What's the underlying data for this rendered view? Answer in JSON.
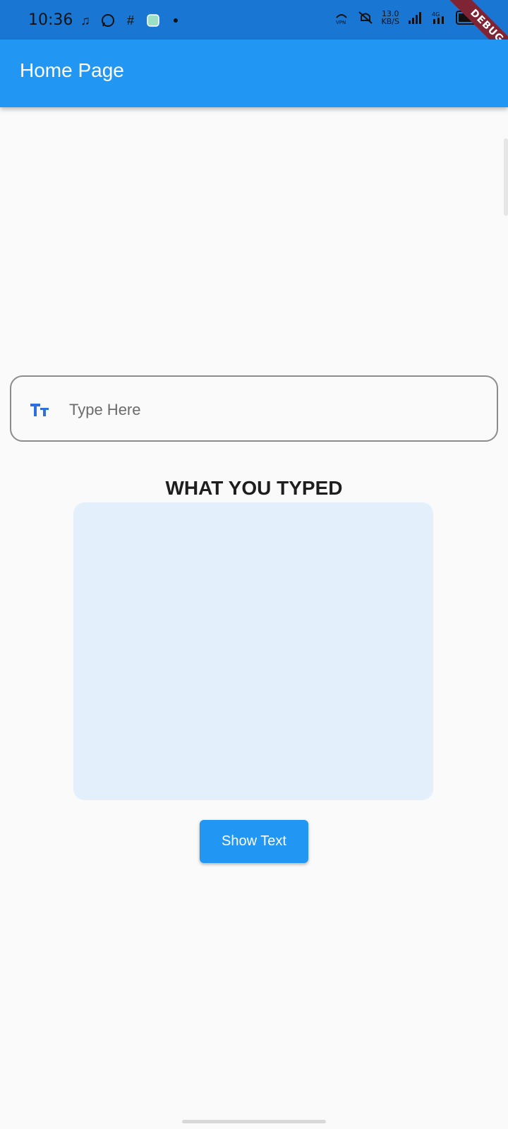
{
  "status_bar": {
    "time": "10:36",
    "left_icons": [
      "music-note-icon",
      "whatsapp-icon",
      "slack-icon",
      "app-icon"
    ],
    "net_speed_value": "13.0",
    "net_speed_unit": "KB/S",
    "right_icons": [
      "vpn-icon",
      "mute-icon",
      "signal-icon",
      "4g-icon",
      "battery-icon"
    ],
    "battery_level": 0.75
  },
  "debug_banner": "DEBUG",
  "app_bar": {
    "title": "Home Page",
    "color": "#2196f3"
  },
  "input": {
    "placeholder": "Type Here",
    "value": "",
    "icon": "text-fields-icon",
    "icon_color": "#2f6fe0"
  },
  "output": {
    "heading": "WHAT YOU TYPED",
    "text": "",
    "box_color": "#e3f0fc"
  },
  "actions": {
    "show_label": "Show Text"
  }
}
